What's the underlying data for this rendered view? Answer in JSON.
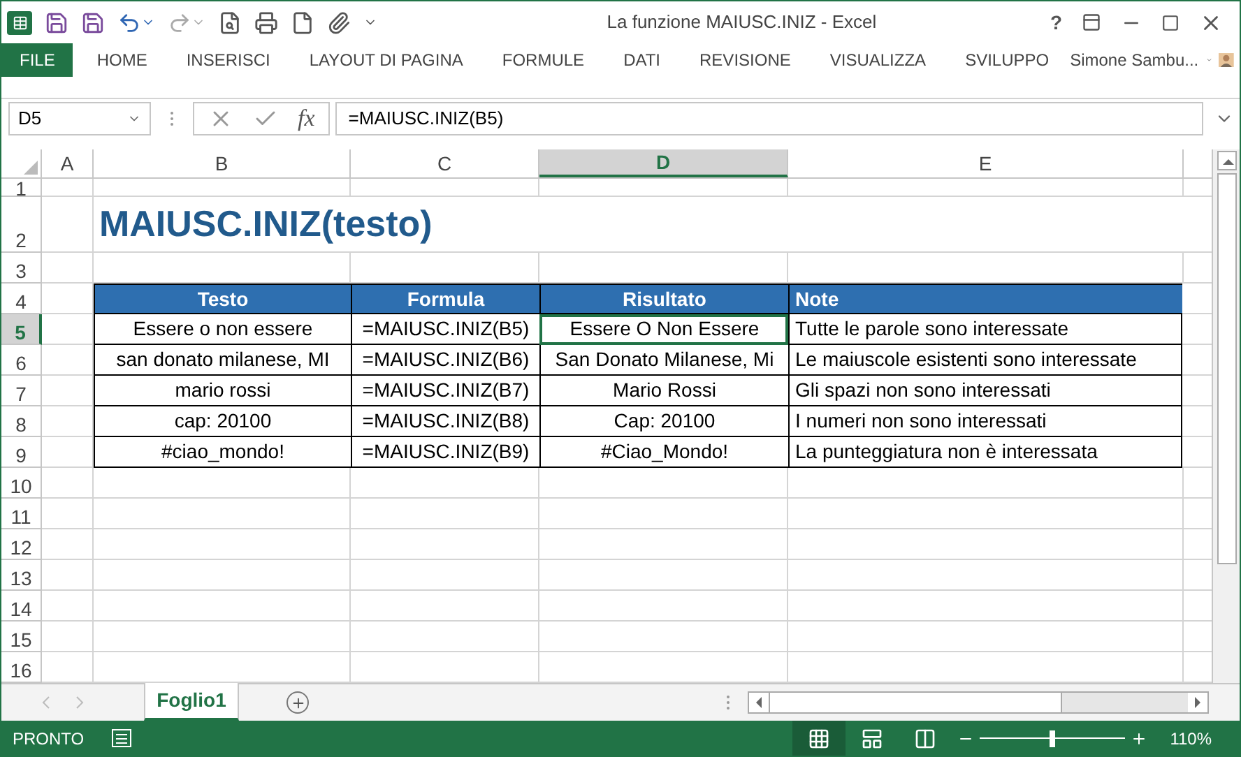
{
  "window": {
    "title": "La funzione MAIUSC.INIZ - Excel",
    "help": "?"
  },
  "ribbon_tabs": [
    {
      "label": "FILE",
      "selected": true
    },
    {
      "label": "HOME",
      "selected": false
    },
    {
      "label": "INSERISCI",
      "selected": false
    },
    {
      "label": "LAYOUT DI PAGINA",
      "selected": false
    },
    {
      "label": "FORMULE",
      "selected": false
    },
    {
      "label": "DATI",
      "selected": false
    },
    {
      "label": "REVISIONE",
      "selected": false
    },
    {
      "label": "VISUALIZZA",
      "selected": false
    },
    {
      "label": "SVILUPPO",
      "selected": false
    }
  ],
  "user": {
    "name": "Simone Sambu..."
  },
  "formula_bar": {
    "name_box": "D5",
    "function_label": "fx",
    "formula": "=MAIUSC.INIZ(B5)"
  },
  "columns": [
    {
      "label": "A",
      "selected": false
    },
    {
      "label": "B",
      "selected": false
    },
    {
      "label": "C",
      "selected": false
    },
    {
      "label": "D",
      "selected": true
    },
    {
      "label": "E",
      "selected": false
    }
  ],
  "rows": [
    {
      "number": "1",
      "selected": false,
      "kind": "empty"
    },
    {
      "number": "2",
      "selected": false,
      "kind": "title",
      "text": "MAIUSC.INIZ(testo)"
    },
    {
      "number": "3",
      "selected": false,
      "kind": "empty"
    },
    {
      "number": "4",
      "selected": false,
      "kind": "table_header",
      "cells": [
        "Testo",
        "Formula",
        "Risultato",
        "Note"
      ]
    },
    {
      "number": "5",
      "selected": true,
      "kind": "table_row",
      "cells": [
        {
          "text": "Essere o non essere",
          "selected": false
        },
        {
          "text": "=MAIUSC.INIZ(B5)",
          "selected": false
        },
        {
          "text": "Essere O Non Essere",
          "selected": true
        },
        {
          "text": "Tutte le parole sono interessate",
          "selected": false
        }
      ]
    },
    {
      "number": "6",
      "selected": false,
      "kind": "table_row",
      "cells": [
        {
          "text": "san donato milanese, MI",
          "selected": false
        },
        {
          "text": "=MAIUSC.INIZ(B6)",
          "selected": false
        },
        {
          "text": "San Donato Milanese, Mi",
          "selected": false
        },
        {
          "text": "Le maiuscole esistenti sono interessate",
          "selected": false
        }
      ]
    },
    {
      "number": "7",
      "selected": false,
      "kind": "table_row",
      "cells": [
        {
          "text": "mario rossi",
          "selected": false
        },
        {
          "text": "=MAIUSC.INIZ(B7)",
          "selected": false
        },
        {
          "text": "Mario Rossi",
          "selected": false
        },
        {
          "text": "Gli spazi non sono interessati",
          "selected": false
        }
      ]
    },
    {
      "number": "8",
      "selected": false,
      "kind": "table_row",
      "cells": [
        {
          "text": "cap: 20100",
          "selected": false
        },
        {
          "text": "=MAIUSC.INIZ(B8)",
          "selected": false
        },
        {
          "text": "Cap: 20100",
          "selected": false
        },
        {
          "text": "I numeri non sono interessati",
          "selected": false
        }
      ]
    },
    {
      "number": "9",
      "selected": false,
      "kind": "table_row",
      "cells": [
        {
          "text": "#ciao_mondo!",
          "selected": false
        },
        {
          "text": "=MAIUSC.INIZ(B9)",
          "selected": false
        },
        {
          "text": "#Ciao_Mondo!",
          "selected": false
        },
        {
          "text": "La punteggiatura non è interessata",
          "selected": false
        }
      ]
    },
    {
      "number": "10",
      "selected": false,
      "kind": "empty"
    },
    {
      "number": "11",
      "selected": false,
      "kind": "empty"
    },
    {
      "number": "12",
      "selected": false,
      "kind": "empty"
    },
    {
      "number": "13",
      "selected": false,
      "kind": "empty"
    },
    {
      "number": "14",
      "selected": false,
      "kind": "empty"
    },
    {
      "number": "15",
      "selected": false,
      "kind": "empty"
    },
    {
      "number": "16",
      "selected": false,
      "kind": "empty"
    }
  ],
  "sheet_tabs": [
    {
      "label": "Foglio1",
      "selected": true
    }
  ],
  "status_bar": {
    "status": "PRONTO",
    "views": [
      {
        "kind": "normal",
        "selected": true
      },
      {
        "kind": "page_layout",
        "selected": false
      },
      {
        "kind": "page_break",
        "selected": false
      }
    ],
    "zoom": {
      "level": 0.5,
      "reading": "110%"
    }
  }
}
